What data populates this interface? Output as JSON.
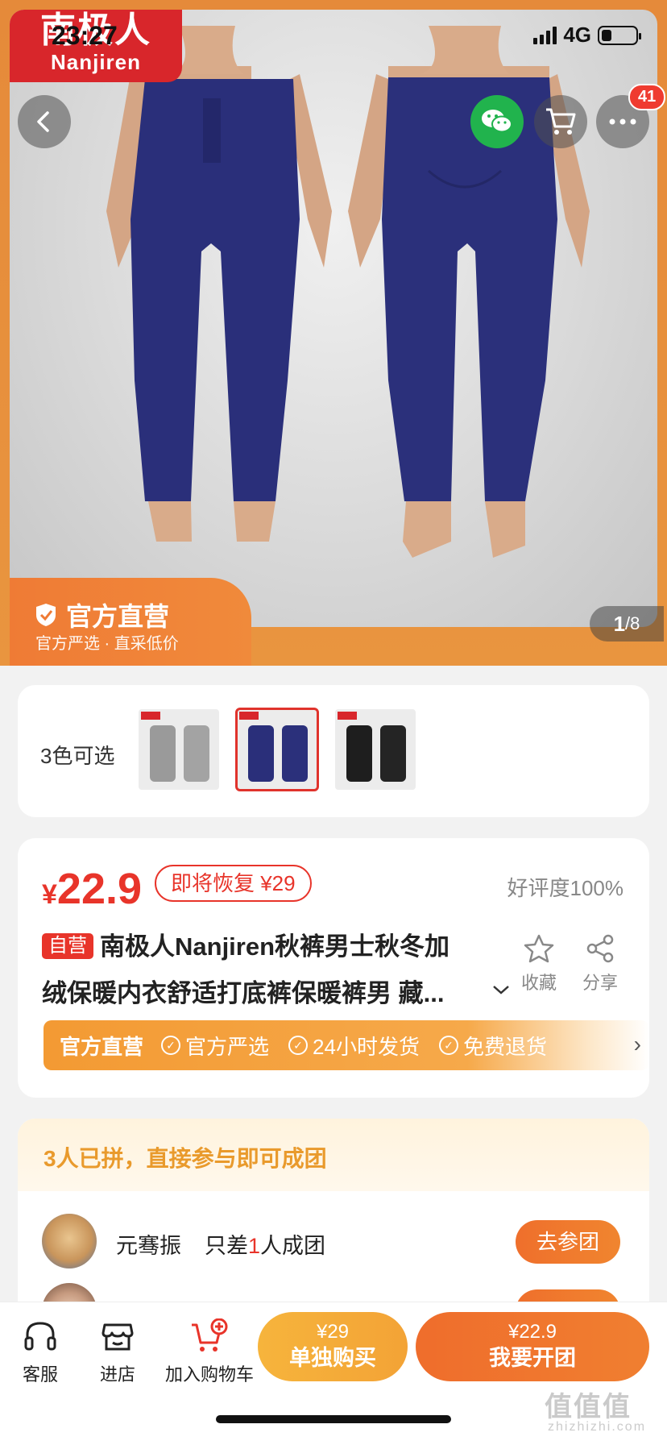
{
  "status_bar": {
    "time": "23:27",
    "network": "4G"
  },
  "brand": {
    "name_cn": "南极人",
    "name_en": "Nanjiren",
    "color": "#d8262b"
  },
  "nav": {
    "cart_badge": "41",
    "icons": [
      "back-icon",
      "wechat-icon",
      "cart-icon",
      "more-icon"
    ]
  },
  "hero": {
    "official_title": "官方直营",
    "official_sub": "官方严选 · 直采低价",
    "pager_current": "1",
    "pager_total": "/8"
  },
  "colors": {
    "label": "3色可选",
    "options": [
      "grey",
      "navy",
      "black"
    ],
    "selected_index": 1
  },
  "product": {
    "price_symbol": "¥",
    "price": "22.9",
    "restore_tag": "即将恢复 ¥29",
    "rating": "好评度100%",
    "self_tag": "自营",
    "title_line1": "南极人Nanjiren秋裤男士秋冬加",
    "title_line2": "绒保暖内衣舒适打底裤保暖裤男 藏...",
    "fav_label": "收藏",
    "share_label": "分享",
    "accent": "#e8342a"
  },
  "services": {
    "main": "官方直营",
    "items": [
      "官方严选",
      "24小时发货",
      "免费退货"
    ]
  },
  "group": {
    "header": "3人已拼，直接参与即可成团",
    "rows": [
      {
        "name": "元骞振",
        "need_prefix": "只差",
        "need_count": "1",
        "need_suffix": "人成团",
        "button": "去参团"
      },
      {
        "name": "",
        "need_prefix": "",
        "need_count": "",
        "need_suffix": "",
        "button": ""
      }
    ]
  },
  "bottom": {
    "service_label": "客服",
    "store_label": "进店",
    "cart_label": "加入购物车",
    "solo_price": "¥29",
    "solo_label": "单独购买",
    "group_price": "¥22.9",
    "group_label": "我要开团"
  },
  "watermark": {
    "text": "值值值",
    "sub": "zhizhizhi.com"
  }
}
